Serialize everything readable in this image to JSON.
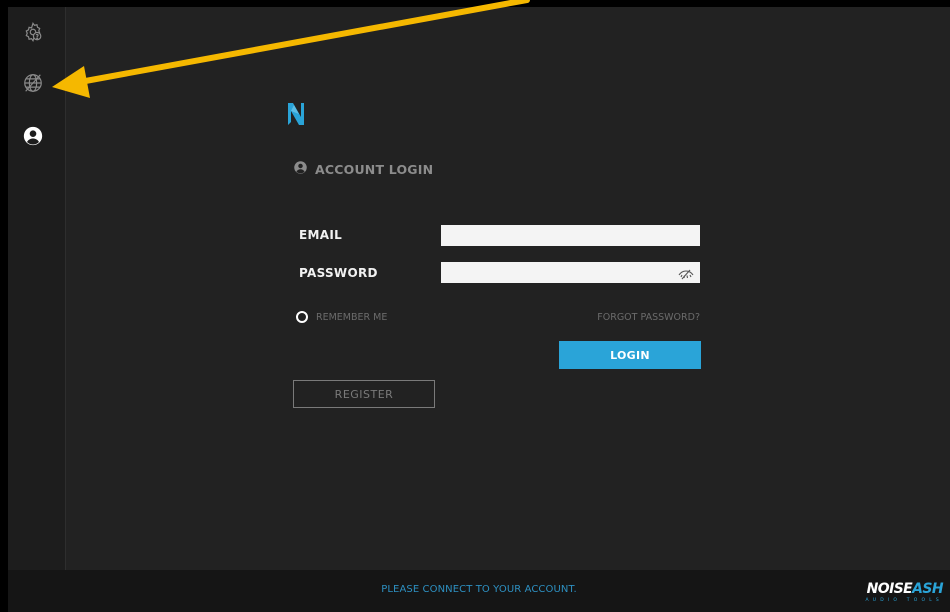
{
  "sidebar": {
    "items": [
      {
        "icon": "settings-gear-icon"
      },
      {
        "icon": "network-globe-icon"
      },
      {
        "icon": "user-account-icon"
      }
    ]
  },
  "login": {
    "section_title": "ACCOUNT LOGIN",
    "email_label": "EMAIL",
    "email_value": "",
    "password_label": "PASSWORD",
    "password_value": "",
    "remember_label": "REMEMBER ME",
    "forgot_label": "FORGOT PASSWORD?",
    "login_label": "LOGIN",
    "register_label": "REGISTER"
  },
  "footer": {
    "message": "PLEASE CONNECT TO YOUR ACCOUNT.",
    "brand_name_part1": "NOISE",
    "brand_name_part2": "ASH",
    "brand_subtitle": "AUDIO TOOLS"
  },
  "colors": {
    "accent": "#2aa4d8",
    "background": "#222222",
    "sidebar": "#1d1d1d",
    "footer": "#151515",
    "annotation_arrow": "#f5b800"
  }
}
